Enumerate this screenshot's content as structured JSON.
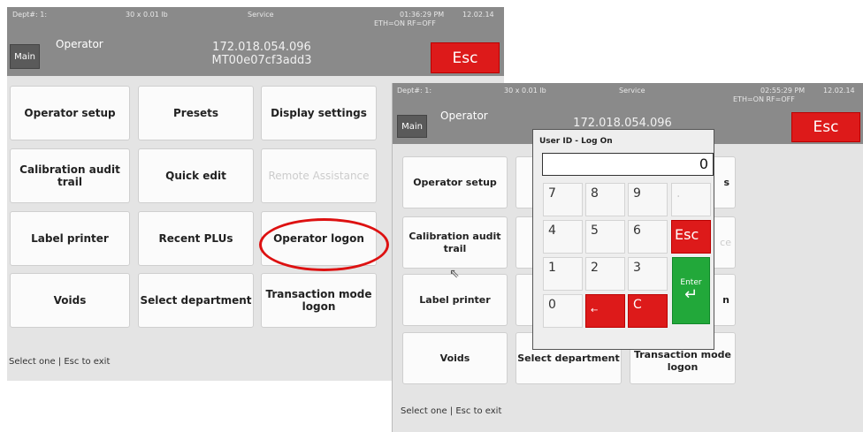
{
  "screen1": {
    "topbar": {
      "dept": "Dept#: 1:",
      "capacity": "30 x 0.01 lb",
      "mode": "Service",
      "time": "01:36:29 PM",
      "date": "12.02.14",
      "network": "ETH=ON RF=OFF",
      "main_label": "Main",
      "operator_label": "Operator",
      "ip": "172.018.054.096",
      "device_id": "MT00e07cf3add3",
      "esc_label": "Esc"
    },
    "buttons": {
      "operator_setup": "Operator setup",
      "presets": "Presets",
      "display_settings": "Display settings",
      "calibration_audit_trail": "Calibration audit trail",
      "quick_edit": "Quick edit",
      "remote_assistance": "Remote Assistance",
      "label_printer": "Label printer",
      "recent_plus": "Recent PLUs",
      "operator_logon": "Operator logon",
      "voids": "Voids",
      "select_department": "Select department",
      "transaction_mode_logon": "Transaction mode logon"
    },
    "status": "Select one | Esc to exit"
  },
  "screen2": {
    "topbar": {
      "dept": "Dept#: 1:",
      "capacity": "30 x 0.01 lb",
      "mode": "Service",
      "time": "02:55:29 PM",
      "date": "12.02.14",
      "network": "ETH=ON RF=OFF",
      "main_label": "Main",
      "operator_label": "Operator",
      "ip": "172.018.054.096",
      "esc_label": "Esc"
    },
    "buttons": {
      "operator_setup": "Operator setup",
      "calibration_audit_trail": "Calibration audit trail",
      "label_printer": "Label printer",
      "voids": "Voids",
      "select_department": "Select department",
      "transaction_mode_logon": "Transaction mode logon",
      "right_1": "s",
      "right_2": "ce",
      "right_3": "n"
    },
    "status": "Select one | Esc to exit",
    "dialog": {
      "title": "User ID - Log On",
      "value": "0",
      "keys": {
        "k7": "7",
        "k8": "8",
        "k9": "9",
        "dot": ".",
        "k4": "4",
        "k5": "5",
        "k6": "6",
        "esc": "Esc",
        "k1": "1",
        "k2": "2",
        "k3": "3",
        "enter": "Enter",
        "enter_arrow": "↵",
        "k0": "0",
        "back": "←",
        "clear": "C"
      }
    }
  },
  "colors": {
    "topbar": "#8a8a8a",
    "esc_red": "#dd1a1a",
    "enter_green": "#22a83a",
    "highlight": "#dd1111"
  }
}
